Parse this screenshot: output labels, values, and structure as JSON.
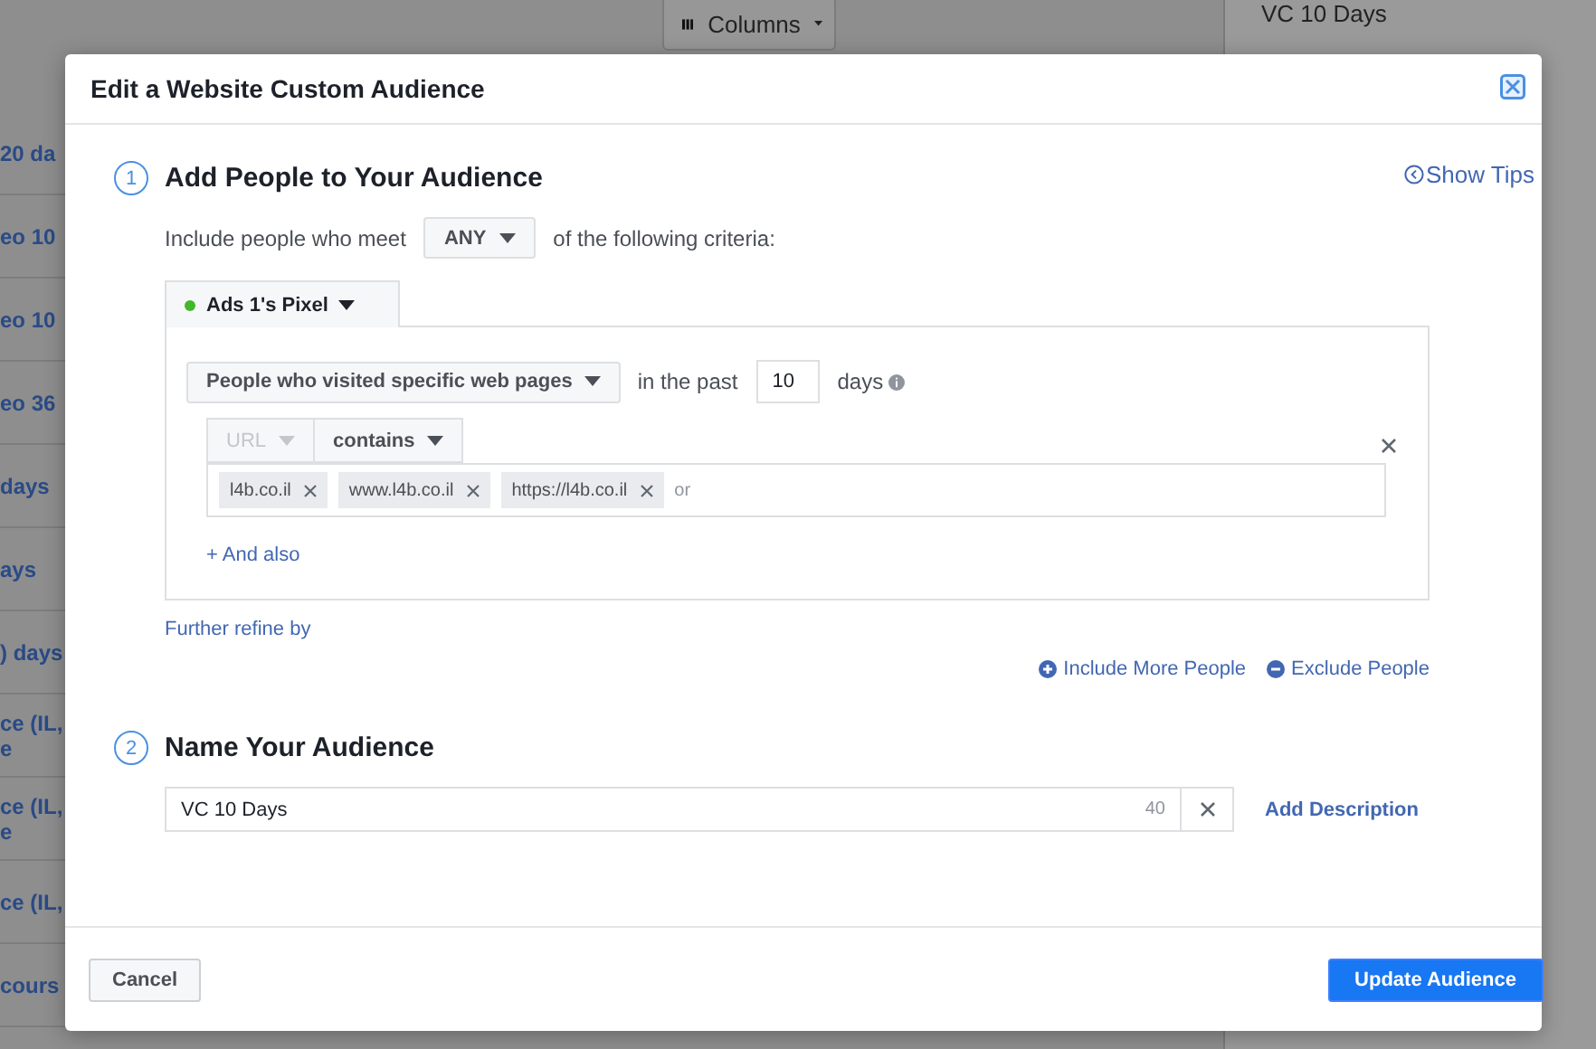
{
  "background": {
    "columns_button": {
      "label": "Columns"
    },
    "panel_title": "VC 10 Days",
    "list_items": [
      {
        "lines": [
          "20 da"
        ]
      },
      {
        "lines": [
          "eo 10"
        ]
      },
      {
        "lines": [
          "eo 10"
        ]
      },
      {
        "lines": [
          "eo 36"
        ]
      },
      {
        "lines": [
          "days"
        ]
      },
      {
        "lines": [
          "ays"
        ]
      },
      {
        "lines": [
          ") days"
        ]
      },
      {
        "lines": [
          "ce (IL,",
          "e"
        ]
      },
      {
        "lines": [
          "ce (IL,",
          "e"
        ]
      },
      {
        "lines": [
          "ce (IL,"
        ]
      },
      {
        "lines": [
          "cours"
        ]
      }
    ]
  },
  "dialog": {
    "title": "Edit a Website Custom Audience",
    "show_tips": "Show Tips",
    "step_1": {
      "number": "1",
      "title": "Add People to Your Audience",
      "criteria": {
        "before": "Include people who meet",
        "match": "ANY",
        "after": "of the following criteria:"
      },
      "pixel": {
        "label": "Ads 1's Pixel",
        "active": true
      },
      "rule": {
        "audience": "People who visited specific web pages",
        "in_the_past": "in the past",
        "days_value": "10",
        "days_unit": "days",
        "field": {
          "label": "URL",
          "disabled": true
        },
        "operator": "contains",
        "tokens": [
          "l4b.co.il",
          "www.l4b.co.il",
          "https://l4b.co.il"
        ],
        "placeholder": "or"
      },
      "and_also": "+ And also",
      "further_refine": "Further refine by",
      "include_more": "Include More People",
      "exclude": "Exclude People"
    },
    "step_2": {
      "number": "2",
      "title": "Name Your Audience",
      "name_value": "VC 10 Days",
      "char_count": "40",
      "add_description": "Add Description"
    },
    "buttons": {
      "cancel": "Cancel",
      "update": "Update Audience"
    }
  }
}
